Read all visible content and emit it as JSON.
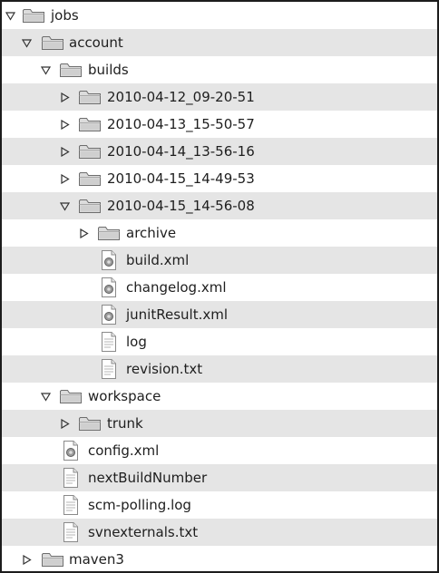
{
  "tree": {
    "jobs": "jobs",
    "account": "account",
    "builds": "builds",
    "build_dirs": [
      "2010-04-12_09-20-51",
      "2010-04-13_15-50-57",
      "2010-04-14_13-56-16",
      "2010-04-15_14-49-53",
      "2010-04-15_14-56-08"
    ],
    "archive": "archive",
    "build_files": [
      "build.xml",
      "changelog.xml",
      "junitResult.xml",
      "log",
      "revision.txt"
    ],
    "workspace": "workspace",
    "trunk": "trunk",
    "account_files": [
      "config.xml",
      "nextBuildNumber",
      "scm-polling.log",
      "svnexternals.txt"
    ],
    "maven3": "maven3"
  },
  "icons": {
    "folder": "folder-icon",
    "xml_file": "xml-file-icon",
    "text_file": "text-file-icon",
    "expanded": "expanded-triangle-icon",
    "collapsed": "collapsed-triangle-icon"
  },
  "colors": {
    "row_alt": "#e5e5e5",
    "border": "#1c1c1c",
    "text": "#1e1e1e"
  }
}
